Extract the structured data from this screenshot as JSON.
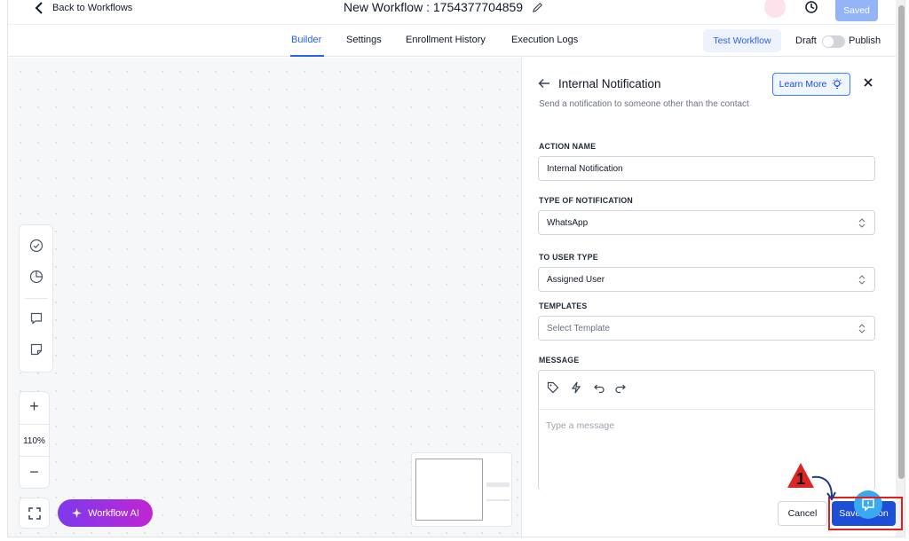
{
  "header": {
    "back_label": "Back to Workflows",
    "workflow_title": "New Workflow : 1754377704859",
    "saved_label": "Saved"
  },
  "tabs": [
    {
      "label": "Builder",
      "active": true
    },
    {
      "label": "Settings",
      "active": false
    },
    {
      "label": "Enrollment History",
      "active": false
    },
    {
      "label": "Execution Logs",
      "active": false
    }
  ],
  "toolbar": {
    "test_workflow_label": "Test Workflow",
    "draft_label": "Draft",
    "publish_label": "Publish",
    "publish_enabled": false
  },
  "canvas": {
    "zoom_label": "110%",
    "workflow_ai_label": "Workflow AI",
    "zoom_in_symbol": "+",
    "zoom_out_symbol": "−"
  },
  "panel": {
    "title": "Internal Notification",
    "subtitle": "Send a notification to someone other than the contact",
    "learn_more_label": "Learn More",
    "fields": {
      "action_name_label": "ACTION NAME",
      "action_name_value": "Internal Notification",
      "type_label": "TYPE OF NOTIFICATION",
      "type_value": "WhatsApp",
      "user_type_label": "TO USER TYPE",
      "user_type_value": "Assigned User",
      "templates_label": "TEMPLATES",
      "templates_placeholder": "Select Template",
      "message_label": "MESSAGE",
      "message_placeholder": "Type a message"
    },
    "cancel_label": "Cancel",
    "save_action_label": "Save Action"
  },
  "annotation": {
    "step_number": "1",
    "highlight_color": "#e11d1d"
  },
  "colors": {
    "accent": "#2563eb",
    "ai_gradient_start": "#7c3aed",
    "ai_gradient_end": "#c026d3",
    "saved_button": "#93b4f7"
  }
}
